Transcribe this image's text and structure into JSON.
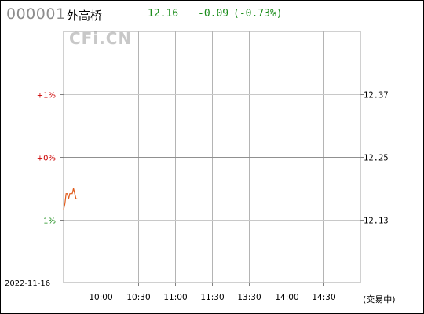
{
  "header": {
    "code": "000001",
    "name": "外高桥",
    "price": "12.16",
    "change": "-0.09",
    "change_pct": "(-0.73%)",
    "colors": {
      "down": "#1a8c1a",
      "up": "#cc0000",
      "code": "#8c8c8c"
    }
  },
  "watermark": "CFi.CN",
  "footer": {
    "date": "2022-11-16",
    "status": "(交易中)"
  },
  "chart_data": {
    "type": "line",
    "title": "",
    "xlabel": "",
    "ylabel": "",
    "x_ticks": [
      "10:00",
      "10:30",
      "11:00",
      "11:30",
      "13:30",
      "14:00",
      "14:30"
    ],
    "session": {
      "start": "09:30",
      "lunch_end": "11:30",
      "resume": "13:00",
      "end": "15:00"
    },
    "ylim": [
      12.01,
      12.49
    ],
    "y_ticks_right": [
      "12.37",
      "12.25",
      "12.13"
    ],
    "y_tick_values": [
      12.37,
      12.25,
      12.13
    ],
    "y_ticks_left": [
      "+1%",
      "+0%",
      "-1%"
    ],
    "reference_close": 12.25,
    "grid": true,
    "series": [
      {
        "color": "#e05a1a",
        "points": [
          [
            "09:30",
            12.15
          ],
          [
            "09:31",
            12.16
          ],
          [
            "09:32",
            12.18
          ],
          [
            "09:33",
            12.18
          ],
          [
            "09:34",
            12.17
          ],
          [
            "09:35",
            12.18
          ],
          [
            "09:36",
            12.18
          ],
          [
            "09:37",
            12.18
          ],
          [
            "09:38",
            12.19
          ],
          [
            "09:39",
            12.18
          ],
          [
            "09:40",
            12.17
          ],
          [
            "09:41",
            12.17
          ]
        ]
      }
    ]
  }
}
